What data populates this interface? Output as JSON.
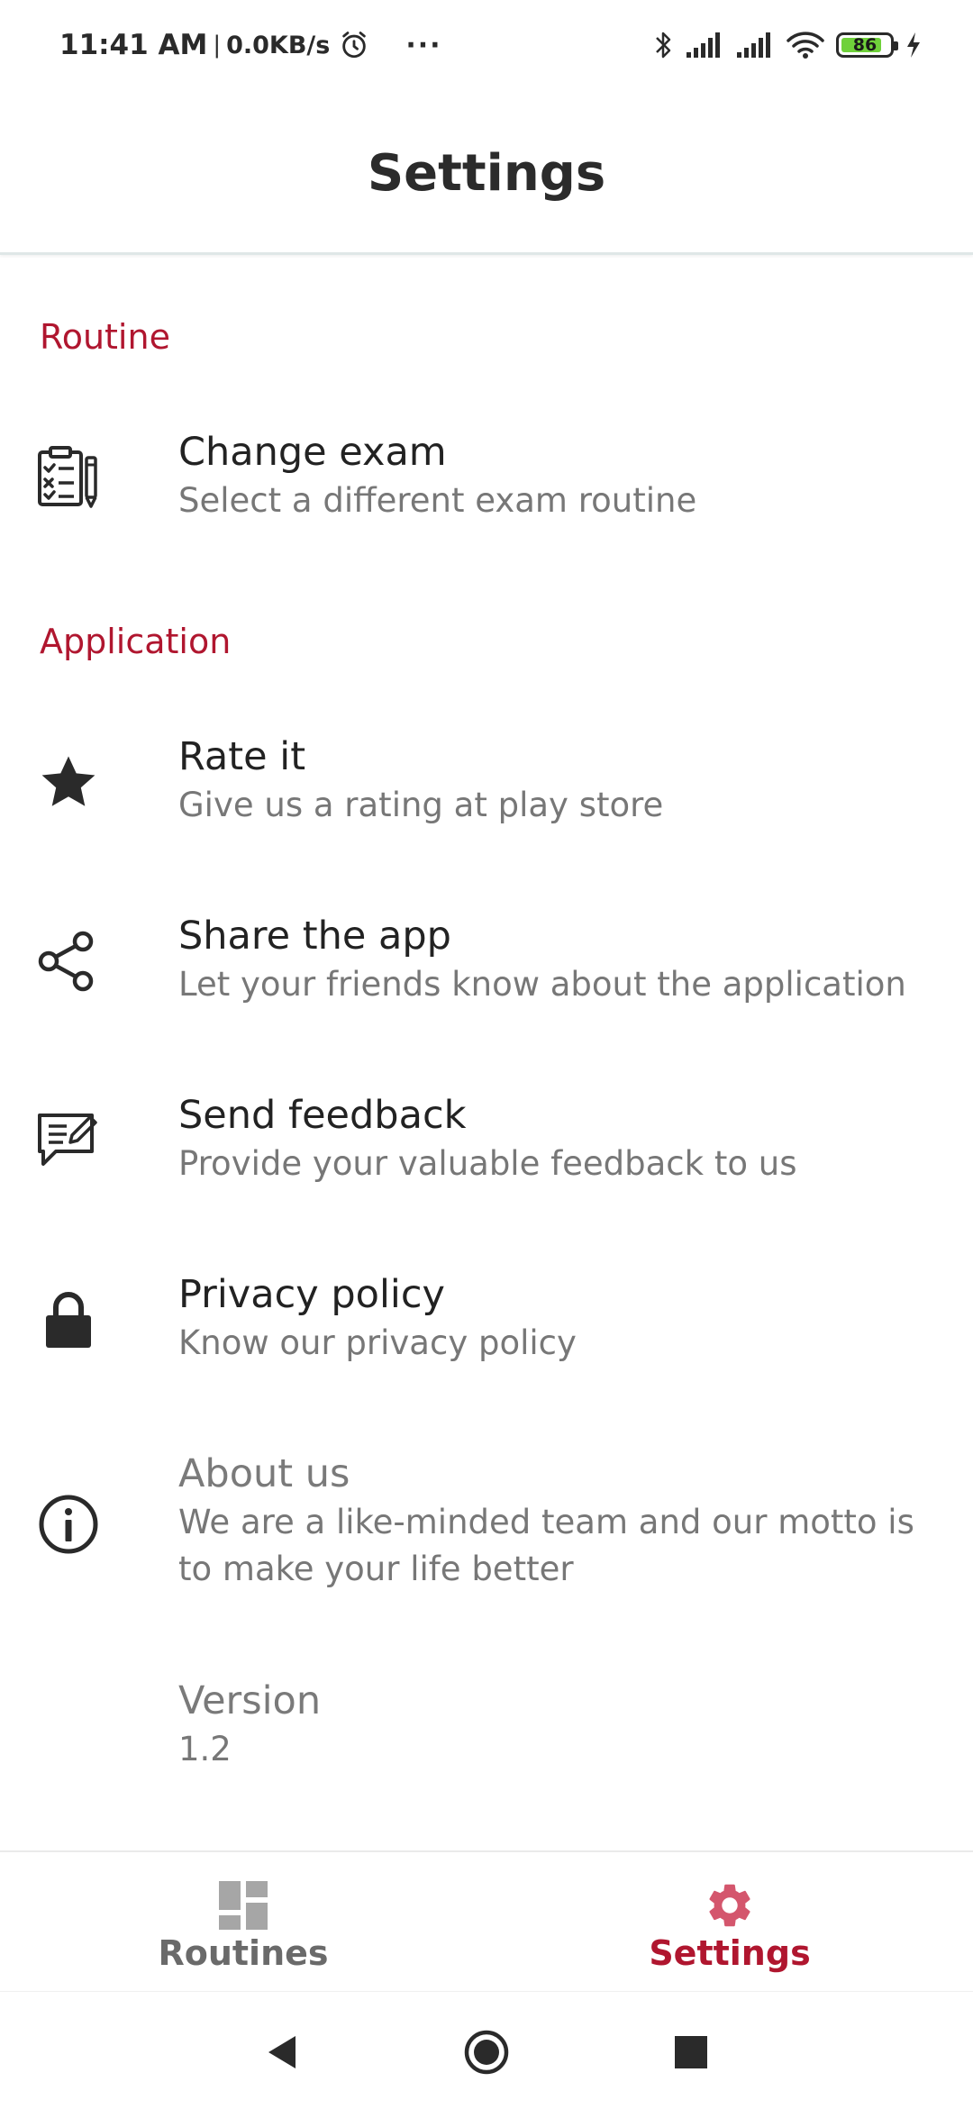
{
  "status_bar": {
    "time": "11:41 AM",
    "separator": "|",
    "network_speed": "0.0KB/s",
    "more_indicator": "···",
    "battery_percent": "86",
    "icons": [
      "alarm-icon",
      "bluetooth-icon",
      "signal-icon",
      "signal-icon",
      "wifi-icon",
      "battery-icon",
      "charging-icon"
    ]
  },
  "app_bar": {
    "title": "Settings"
  },
  "sections": {
    "routine": {
      "header": "Routine",
      "change_exam": {
        "icon": "clipboard-checklist-icon",
        "title": "Change exam",
        "subtitle": "Select a different exam routine"
      }
    },
    "application": {
      "header": "Application",
      "rate": {
        "icon": "star-icon",
        "title": "Rate it",
        "subtitle": "Give us a rating at play store"
      },
      "share": {
        "icon": "share-icon",
        "title": "Share the app",
        "subtitle": "Let your friends know about the application"
      },
      "feedback": {
        "icon": "feedback-icon",
        "title": "Send feedback",
        "subtitle": "Provide your valuable feedback to us"
      },
      "privacy": {
        "icon": "lock-icon",
        "title": "Privacy policy",
        "subtitle": "Know our privacy policy"
      },
      "about": {
        "icon": "info-icon",
        "title": "About us",
        "subtitle": "We are a like-minded team and our motto is to make your life better"
      },
      "version": {
        "title": "Version",
        "value": "1.2"
      }
    }
  },
  "bottom_nav": {
    "routines": {
      "label": "Routines",
      "icon": "dashboard-icon",
      "active": false
    },
    "settings": {
      "label": "Settings",
      "icon": "gear-icon",
      "active": true
    }
  },
  "colors": {
    "accent": "#b0162f",
    "nav_active": "#b0162f",
    "nav_active_icon": "#d4566d",
    "nav_inactive": "#6a6a6a",
    "nav_inactive_icon": "#a6a6a6",
    "icon_dark": "#2a2a2a",
    "title_text": "#222222",
    "subtitle_text": "#777777"
  }
}
